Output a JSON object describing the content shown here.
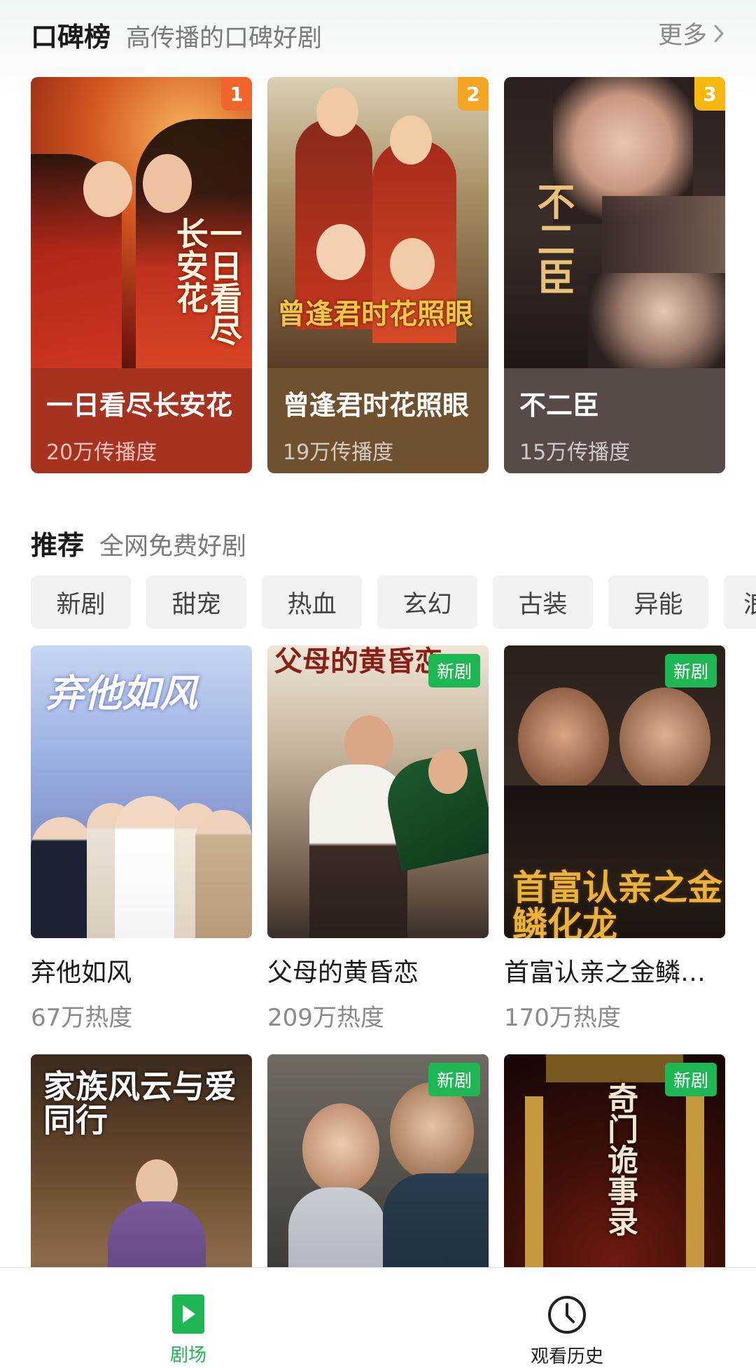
{
  "ranking": {
    "title": "口碑榜",
    "subtitle": "高传播的口碑好剧",
    "more_label": "更多",
    "items": [
      {
        "rank": "1",
        "title": "一日看尽长安花",
        "stat": "20万传播度",
        "poster_text": "一日看尽长安花",
        "badge_color": "#f0652a",
        "info_bg": "#a6331f"
      },
      {
        "rank": "2",
        "title": "曾逢君时花照眼",
        "stat": "19万传播度",
        "poster_text": "曾逢君时花照眼",
        "badge_color": "#f5a524",
        "info_bg": "#6f5130"
      },
      {
        "rank": "3",
        "title": "不二臣",
        "stat": "15万传播度",
        "poster_text": "不二臣",
        "badge_color": "#f6b80e",
        "info_bg": "#584a47"
      }
    ]
  },
  "recommend": {
    "title": "推荐",
    "subtitle": "全网免费好剧",
    "tags": [
      "新剧",
      "甜宠",
      "热血",
      "玄幻",
      "古装",
      "异能",
      "浪"
    ],
    "new_badge": "新剧",
    "row1": [
      {
        "title": "弃他如风",
        "stat": "67万热度",
        "poster_text": "弃他如风"
      },
      {
        "title": "父母的黄昏恋",
        "stat": "209万热度",
        "poster_text": "父母的黄昏恋"
      },
      {
        "title": "首富认亲之金鳞…",
        "stat": "170万热度",
        "poster_text": "首富认亲之金鳞化龙"
      }
    ],
    "row2": [
      {
        "poster_text": "家族风云与爱同行"
      },
      {
        "poster_text": ""
      },
      {
        "poster_text": "奇门诡事录"
      }
    ]
  },
  "tabbar": {
    "items": [
      {
        "label": "剧场",
        "icon": "play-icon",
        "active": true
      },
      {
        "label": "观看历史",
        "icon": "clock-icon",
        "active": false
      }
    ],
    "active_color": "#1fb754"
  }
}
